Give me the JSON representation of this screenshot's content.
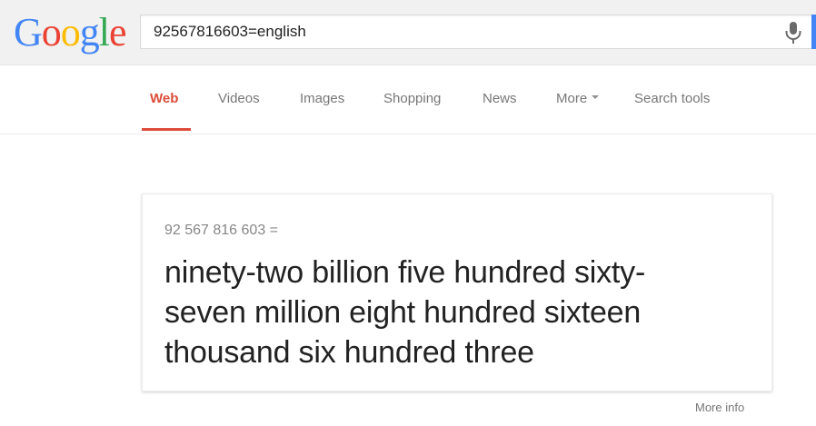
{
  "header": {
    "logo_text": "Google",
    "logo_letters": [
      {
        "char": "G",
        "color": "#4285f4"
      },
      {
        "char": "o",
        "color": "#ea4335"
      },
      {
        "char": "o",
        "color": "#fbbc05"
      },
      {
        "char": "g",
        "color": "#4285f4"
      },
      {
        "char": "l",
        "color": "#34a853"
      },
      {
        "char": "e",
        "color": "#ea4335"
      }
    ],
    "search_value": "92567816603=english",
    "mic_icon": "microphone-icon"
  },
  "tabs": [
    {
      "label": "Web",
      "active": true
    },
    {
      "label": "Videos",
      "active": false
    },
    {
      "label": "Images",
      "active": false
    },
    {
      "label": "Shopping",
      "active": false
    },
    {
      "label": "News",
      "active": false
    },
    {
      "label": "More",
      "active": false,
      "has_dropdown": true
    },
    {
      "label": "Search tools",
      "active": false
    }
  ],
  "result": {
    "query": "92 567 816 603 =",
    "answer_lines": [
      "ninety-two billion five hundred sixty-",
      "seven million eight hundred sixteen",
      "thousand six hundred three"
    ],
    "more_info": "More info"
  },
  "colors": {
    "accent_red": "#dd4b39",
    "blue_edge": "#4285f4",
    "topbar_bg": "#f1f1f1"
  }
}
